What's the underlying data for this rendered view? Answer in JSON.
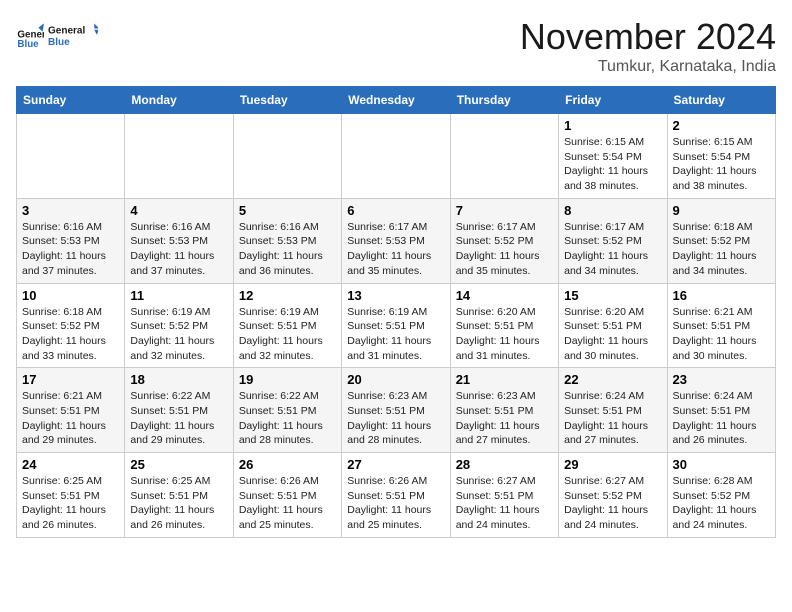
{
  "logo": {
    "line1": "General",
    "line2": "Blue"
  },
  "title": "November 2024",
  "location": "Tumkur, Karnataka, India",
  "days_of_week": [
    "Sunday",
    "Monday",
    "Tuesday",
    "Wednesday",
    "Thursday",
    "Friday",
    "Saturday"
  ],
  "weeks": [
    [
      {
        "day": "",
        "text": ""
      },
      {
        "day": "",
        "text": ""
      },
      {
        "day": "",
        "text": ""
      },
      {
        "day": "",
        "text": ""
      },
      {
        "day": "",
        "text": ""
      },
      {
        "day": "1",
        "text": "Sunrise: 6:15 AM\nSunset: 5:54 PM\nDaylight: 11 hours and 38 minutes."
      },
      {
        "day": "2",
        "text": "Sunrise: 6:15 AM\nSunset: 5:54 PM\nDaylight: 11 hours and 38 minutes."
      }
    ],
    [
      {
        "day": "3",
        "text": "Sunrise: 6:16 AM\nSunset: 5:53 PM\nDaylight: 11 hours and 37 minutes."
      },
      {
        "day": "4",
        "text": "Sunrise: 6:16 AM\nSunset: 5:53 PM\nDaylight: 11 hours and 37 minutes."
      },
      {
        "day": "5",
        "text": "Sunrise: 6:16 AM\nSunset: 5:53 PM\nDaylight: 11 hours and 36 minutes."
      },
      {
        "day": "6",
        "text": "Sunrise: 6:17 AM\nSunset: 5:53 PM\nDaylight: 11 hours and 35 minutes."
      },
      {
        "day": "7",
        "text": "Sunrise: 6:17 AM\nSunset: 5:52 PM\nDaylight: 11 hours and 35 minutes."
      },
      {
        "day": "8",
        "text": "Sunrise: 6:17 AM\nSunset: 5:52 PM\nDaylight: 11 hours and 34 minutes."
      },
      {
        "day": "9",
        "text": "Sunrise: 6:18 AM\nSunset: 5:52 PM\nDaylight: 11 hours and 34 minutes."
      }
    ],
    [
      {
        "day": "10",
        "text": "Sunrise: 6:18 AM\nSunset: 5:52 PM\nDaylight: 11 hours and 33 minutes."
      },
      {
        "day": "11",
        "text": "Sunrise: 6:19 AM\nSunset: 5:52 PM\nDaylight: 11 hours and 32 minutes."
      },
      {
        "day": "12",
        "text": "Sunrise: 6:19 AM\nSunset: 5:51 PM\nDaylight: 11 hours and 32 minutes."
      },
      {
        "day": "13",
        "text": "Sunrise: 6:19 AM\nSunset: 5:51 PM\nDaylight: 11 hours and 31 minutes."
      },
      {
        "day": "14",
        "text": "Sunrise: 6:20 AM\nSunset: 5:51 PM\nDaylight: 11 hours and 31 minutes."
      },
      {
        "day": "15",
        "text": "Sunrise: 6:20 AM\nSunset: 5:51 PM\nDaylight: 11 hours and 30 minutes."
      },
      {
        "day": "16",
        "text": "Sunrise: 6:21 AM\nSunset: 5:51 PM\nDaylight: 11 hours and 30 minutes."
      }
    ],
    [
      {
        "day": "17",
        "text": "Sunrise: 6:21 AM\nSunset: 5:51 PM\nDaylight: 11 hours and 29 minutes."
      },
      {
        "day": "18",
        "text": "Sunrise: 6:22 AM\nSunset: 5:51 PM\nDaylight: 11 hours and 29 minutes."
      },
      {
        "day": "19",
        "text": "Sunrise: 6:22 AM\nSunset: 5:51 PM\nDaylight: 11 hours and 28 minutes."
      },
      {
        "day": "20",
        "text": "Sunrise: 6:23 AM\nSunset: 5:51 PM\nDaylight: 11 hours and 28 minutes."
      },
      {
        "day": "21",
        "text": "Sunrise: 6:23 AM\nSunset: 5:51 PM\nDaylight: 11 hours and 27 minutes."
      },
      {
        "day": "22",
        "text": "Sunrise: 6:24 AM\nSunset: 5:51 PM\nDaylight: 11 hours and 27 minutes."
      },
      {
        "day": "23",
        "text": "Sunrise: 6:24 AM\nSunset: 5:51 PM\nDaylight: 11 hours and 26 minutes."
      }
    ],
    [
      {
        "day": "24",
        "text": "Sunrise: 6:25 AM\nSunset: 5:51 PM\nDaylight: 11 hours and 26 minutes."
      },
      {
        "day": "25",
        "text": "Sunrise: 6:25 AM\nSunset: 5:51 PM\nDaylight: 11 hours and 26 minutes."
      },
      {
        "day": "26",
        "text": "Sunrise: 6:26 AM\nSunset: 5:51 PM\nDaylight: 11 hours and 25 minutes."
      },
      {
        "day": "27",
        "text": "Sunrise: 6:26 AM\nSunset: 5:51 PM\nDaylight: 11 hours and 25 minutes."
      },
      {
        "day": "28",
        "text": "Sunrise: 6:27 AM\nSunset: 5:51 PM\nDaylight: 11 hours and 24 minutes."
      },
      {
        "day": "29",
        "text": "Sunrise: 6:27 AM\nSunset: 5:52 PM\nDaylight: 11 hours and 24 minutes."
      },
      {
        "day": "30",
        "text": "Sunrise: 6:28 AM\nSunset: 5:52 PM\nDaylight: 11 hours and 24 minutes."
      }
    ]
  ]
}
